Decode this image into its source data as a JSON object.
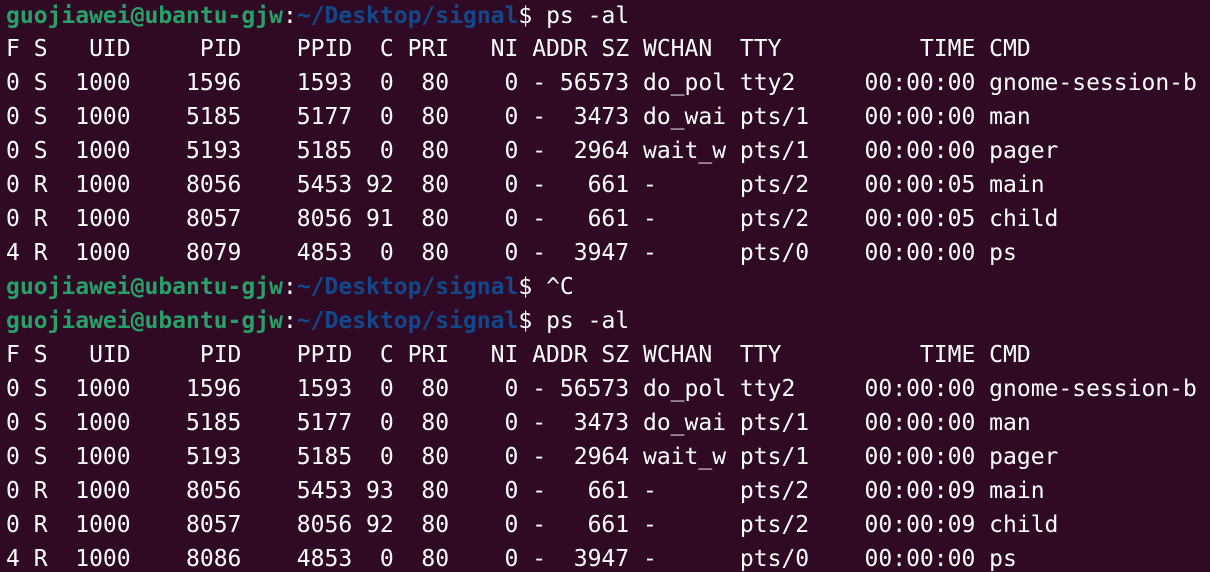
{
  "terminal": {
    "lines": [
      {
        "type": "prompt",
        "user": "guojiawei@ubantu-gjw",
        "path": "~/Desktop/signal",
        "command": " ps -al"
      },
      {
        "type": "out",
        "text": "F S   UID     PID    PPID  C PRI   NI ADDR SZ WCHAN  TTY          TIME CMD"
      },
      {
        "type": "out",
        "text": "0 S  1000    1596    1593  0  80    0 - 56573 do_pol tty2     00:00:00 gnome-session-b"
      },
      {
        "type": "out",
        "text": "0 S  1000    5185    5177  0  80    0 -  3473 do_wai pts/1    00:00:00 man"
      },
      {
        "type": "out",
        "text": "0 S  1000    5193    5185  0  80    0 -  2964 wait_w pts/1    00:00:00 pager"
      },
      {
        "type": "out",
        "text": "0 R  1000    8056    5453 92  80    0 -   661 -      pts/2    00:00:05 main"
      },
      {
        "type": "out",
        "text": "0 R  1000    8057    8056 91  80    0 -   661 -      pts/2    00:00:05 child"
      },
      {
        "type": "out",
        "text": "4 R  1000    8079    4853  0  80    0 -  3947 -      pts/0    00:00:00 ps"
      },
      {
        "type": "prompt",
        "user": "guojiawei@ubantu-gjw",
        "path": "~/Desktop/signal",
        "command": " ^C"
      },
      {
        "type": "prompt",
        "user": "guojiawei@ubantu-gjw",
        "path": "~/Desktop/signal",
        "command": " ps -al"
      },
      {
        "type": "out",
        "text": "F S   UID     PID    PPID  C PRI   NI ADDR SZ WCHAN  TTY          TIME CMD"
      },
      {
        "type": "out",
        "text": "0 S  1000    1596    1593  0  80    0 - 56573 do_pol tty2     00:00:00 gnome-session-b"
      },
      {
        "type": "out",
        "text": "0 S  1000    5185    5177  0  80    0 -  3473 do_wai pts/1    00:00:00 man"
      },
      {
        "type": "out",
        "text": "0 S  1000    5193    5185  0  80    0 -  2964 wait_w pts/1    00:00:00 pager"
      },
      {
        "type": "out",
        "text": "0 R  1000    8056    5453 93  80    0 -   661 -      pts/2    00:00:09 main"
      },
      {
        "type": "out",
        "text": "0 R  1000    8057    8056 92  80    0 -   661 -      pts/2    00:00:09 child"
      },
      {
        "type": "out",
        "text": "4 R  1000    8086    4853  0  80    0 -  3947 -      pts/0    00:00:00 ps"
      }
    ]
  },
  "colors": {
    "background": "#300a24",
    "prompt_user": "#26a269",
    "prompt_path": "#12488b",
    "text": "#ffffff"
  }
}
